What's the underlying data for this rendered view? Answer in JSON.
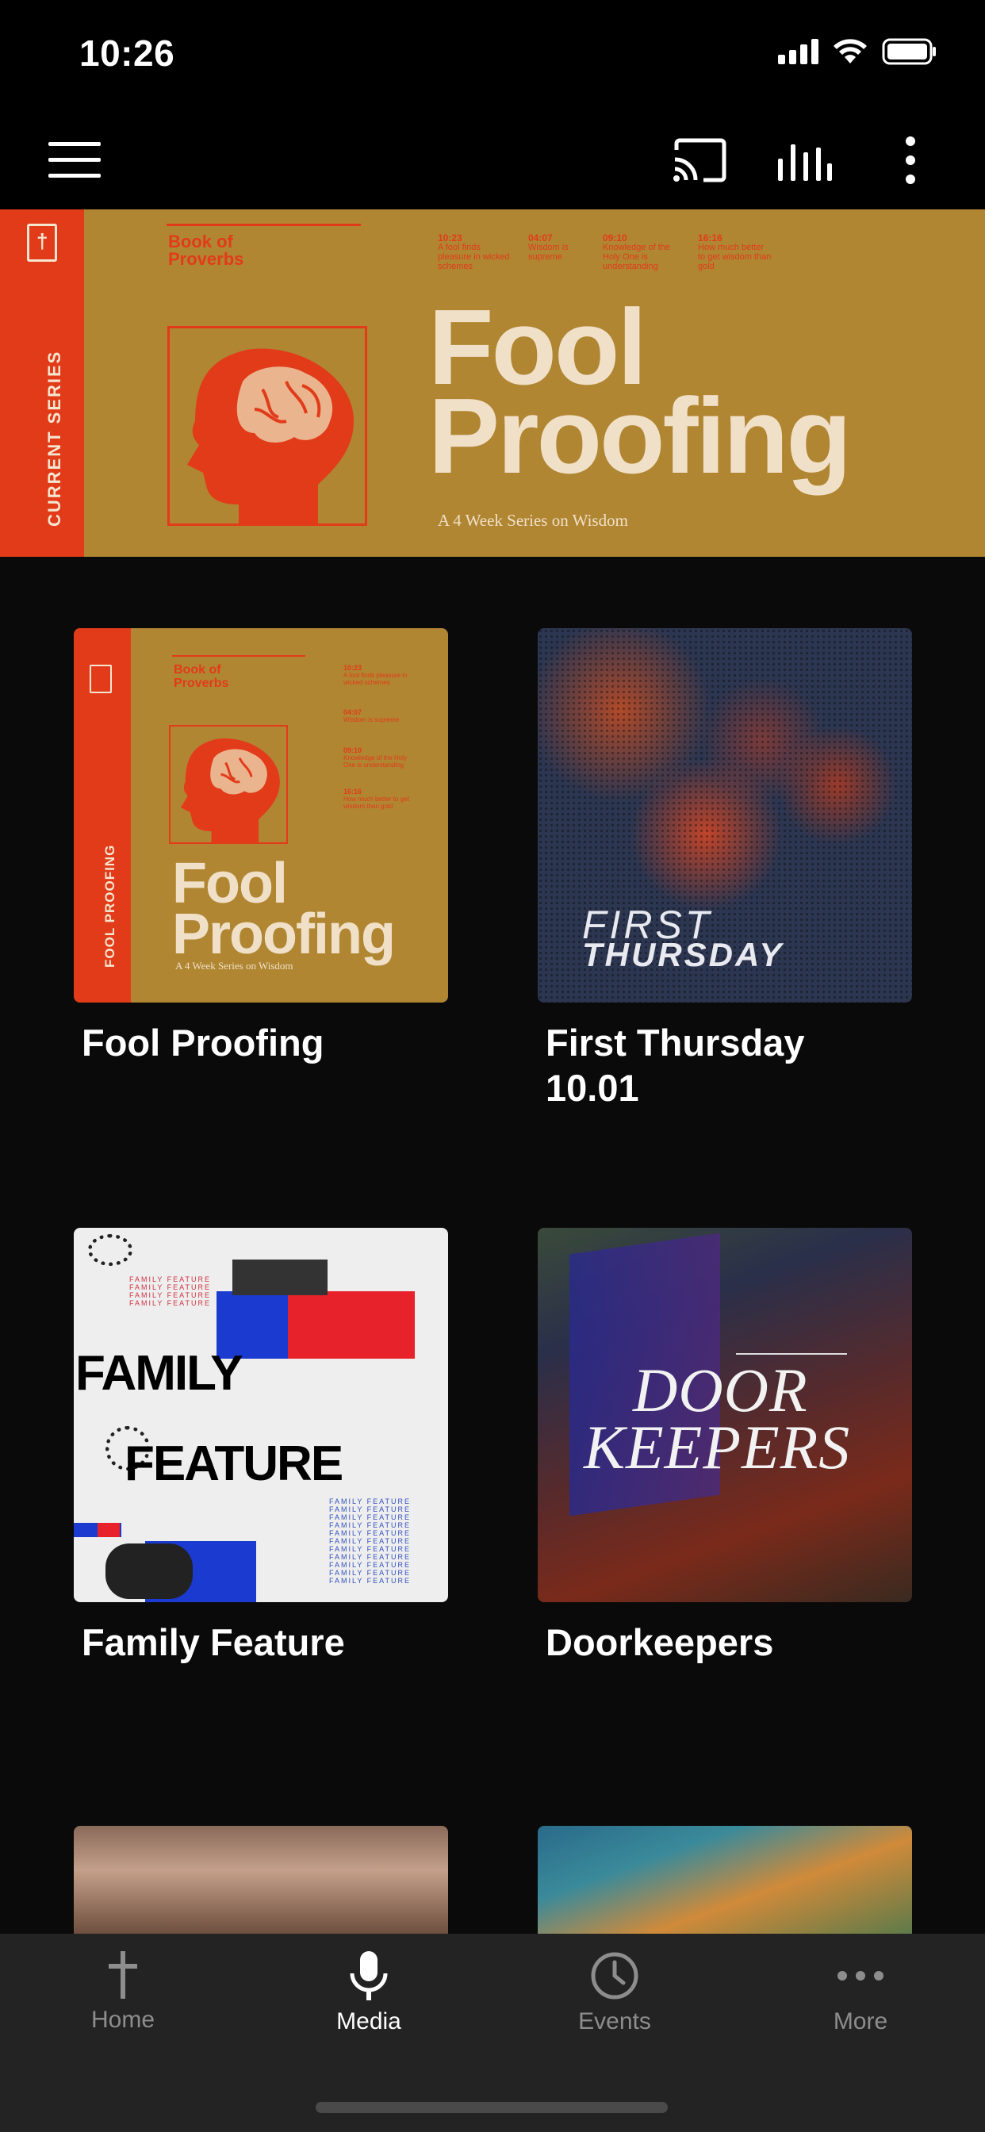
{
  "status_bar": {
    "time": "10:26"
  },
  "nav": {
    "menu_icon": "hamburger-icon",
    "cast_icon": "cast-icon",
    "audio_icon": "audio-bars-icon",
    "overflow_icon": "vertical-dots-icon"
  },
  "hero": {
    "side_label": "CURRENT SERIES",
    "book": "Book of Proverbs",
    "verses": [
      {
        "ref": "10:23",
        "text": "A fool finds pleasure in wicked schemes"
      },
      {
        "ref": "04:07",
        "text": "Wisdom is supreme"
      },
      {
        "ref": "09:10",
        "text": "Knowledge of the Holy One is understanding"
      },
      {
        "ref": "16:16",
        "text": "How much better to get wisdom than gold"
      }
    ],
    "title_line1": "Fool",
    "title_line2": "Proofing",
    "subtitle": "A 4 Week Series on Wisdom",
    "colors": {
      "gold": "#b08632",
      "red": "#e23b1a",
      "cream": "#f0e0c8"
    }
  },
  "cards": [
    {
      "title": "Fool Proofing",
      "art": {
        "side_label": "FOOL PROOFING",
        "book": "Book of Proverbs",
        "title_line1": "Fool",
        "title_line2": "Proofing",
        "subtitle": "A 4 Week Series on Wisdom",
        "verses": [
          {
            "ref": "10:23",
            "text": "A fool finds pleasure in wicked schemes"
          },
          {
            "ref": "04:07",
            "text": "Wisdom is supreme"
          },
          {
            "ref": "09:10",
            "text": "Knowledge of the Holy One is understanding"
          },
          {
            "ref": "16:16",
            "text": "How much better to get wisdom than gold"
          }
        ]
      }
    },
    {
      "title": "First Thursday 10.01",
      "art": {
        "line1": "FIRST",
        "line2": "THURSDAY"
      }
    },
    {
      "title": "Family Feature",
      "art": {
        "word1": "FAMILY",
        "word2": "FEATURE",
        "repeat": "FAMILY FEATURE"
      }
    },
    {
      "title": "Doorkeepers",
      "art": {
        "word1": "DOOR",
        "word2": "KEEPERS"
      }
    }
  ],
  "tabs": [
    {
      "label": "Home",
      "icon": "cross-icon",
      "active": false
    },
    {
      "label": "Media",
      "icon": "microphone-icon",
      "active": true
    },
    {
      "label": "Events",
      "icon": "clock-icon",
      "active": false
    },
    {
      "label": "More",
      "icon": "horizontal-dots-icon",
      "active": false
    }
  ]
}
